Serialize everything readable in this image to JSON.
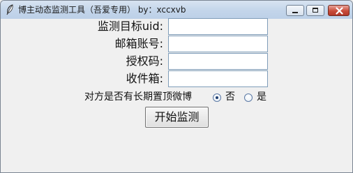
{
  "window": {
    "title": "博主动态监测工具（吾爱专用） by：xccxvb",
    "app_icon": "feather-icon"
  },
  "form": {
    "uid_label": "监测目标uid:",
    "uid_value": "",
    "email_label": "邮箱账号:",
    "email_value": "",
    "auth_code_label": "授权码:",
    "auth_code_value": "",
    "inbox_label": "收件箱:",
    "inbox_value": ""
  },
  "pinned_option": {
    "question": "对方是否有长期置顶微博",
    "no_label": "否",
    "yes_label": "是",
    "selected": "否"
  },
  "actions": {
    "start_label": "开始监测"
  }
}
